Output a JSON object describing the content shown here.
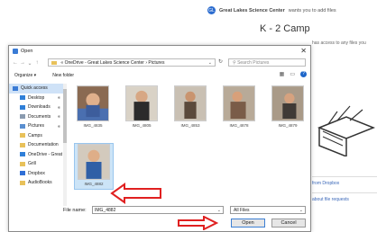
{
  "background": {
    "org_initials": "GL",
    "org_name": "Great Lakes Science Center",
    "org_message": "wants you to add files",
    "page_title": "K - 2 Camp",
    "access_note": "has access to any files you",
    "link_dropbox": "from Dropbox",
    "link_requests": "about file requests"
  },
  "dialog": {
    "title": "Open",
    "close_icon": "close-icon",
    "address": {
      "prefix": "«",
      "path": "OneDrive - Great Lakes Science Center › Pictures"
    },
    "search_placeholder": "Search Pictures",
    "toolbar": {
      "organize": "Organize ▾",
      "new_folder": "New folder",
      "help": "?"
    },
    "nav_items": [
      {
        "label": "Quick access",
        "icon": "star-icon",
        "color": "#3a7bd5"
      },
      {
        "label": "Desktop",
        "icon": "desktop-icon",
        "color": "#2f7fd8"
      },
      {
        "label": "Downloads",
        "icon": "download-icon",
        "color": "#2f7fd8"
      },
      {
        "label": "Documents",
        "icon": "document-icon",
        "color": "#8a9bb0"
      },
      {
        "label": "Pictures",
        "icon": "picture-icon",
        "color": "#5a8fd0"
      },
      {
        "label": "Camps",
        "icon": "folder-icon",
        "color": "#e8c15a"
      },
      {
        "label": "Documentation",
        "icon": "folder-icon",
        "color": "#e8c15a"
      },
      {
        "label": "OneDrive - Great",
        "icon": "cloud-icon",
        "color": "#2f7fd8"
      },
      {
        "label": "Grill",
        "icon": "folder-icon",
        "color": "#e8c15a"
      },
      {
        "label": "Dropbox",
        "icon": "dropbox-icon",
        "color": "#2f6fd6"
      },
      {
        "label": "AudioBooks",
        "icon": "folder-icon",
        "color": "#e8c15a"
      }
    ],
    "files": [
      {
        "name": "IMG_4835",
        "selected": false
      },
      {
        "name": "IMG_4805",
        "selected": false
      },
      {
        "name": "IMG_4853",
        "selected": false
      },
      {
        "name": "IMG_4878",
        "selected": false
      },
      {
        "name": "IMG_4879",
        "selected": false
      },
      {
        "name": "IMG_4882",
        "selected": true
      }
    ],
    "file_name_label": "File name:",
    "file_name_value": "IMG_4882",
    "file_type": "All Files",
    "open_button": "Open",
    "cancel_button": "Cancel"
  }
}
